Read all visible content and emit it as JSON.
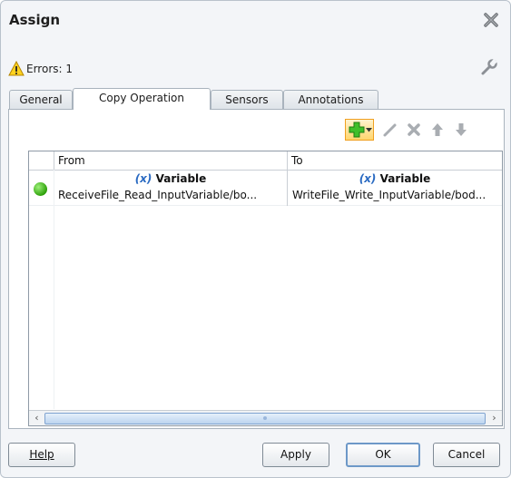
{
  "dialog": {
    "title": "Assign",
    "close_icon": "close-icon",
    "errors_text": "Errors: 1",
    "warning_icon": "warning-icon",
    "wrench_icon": "wrench-icon"
  },
  "tabs": [
    {
      "label": "General",
      "active": false
    },
    {
      "label": "Copy Operation",
      "active": true
    },
    {
      "label": "Sensors",
      "active": false
    },
    {
      "label": "Annotations",
      "active": false
    }
  ],
  "toolbar": {
    "icons": [
      "add-icon",
      "edit-icon",
      "delete-icon",
      "move-up-icon",
      "move-down-icon"
    ]
  },
  "table": {
    "columns": [
      "From",
      "To"
    ],
    "rows": [
      {
        "status": "valid",
        "from": {
          "prefix": "(x)",
          "type": "Variable",
          "path": "ReceiveFile_Read_InputVariable/bo..."
        },
        "to": {
          "prefix": "(x)",
          "type": "Variable",
          "path": "WriteFile_Write_InputVariable/bod..."
        }
      }
    ]
  },
  "buttons": {
    "help": "Help",
    "apply": "Apply",
    "ok": "OK",
    "cancel": "Cancel"
  },
  "colors": {
    "accent": "#2a6ac2",
    "status_ok": "#2ea10a",
    "add_highlight": "#ffd66e"
  }
}
